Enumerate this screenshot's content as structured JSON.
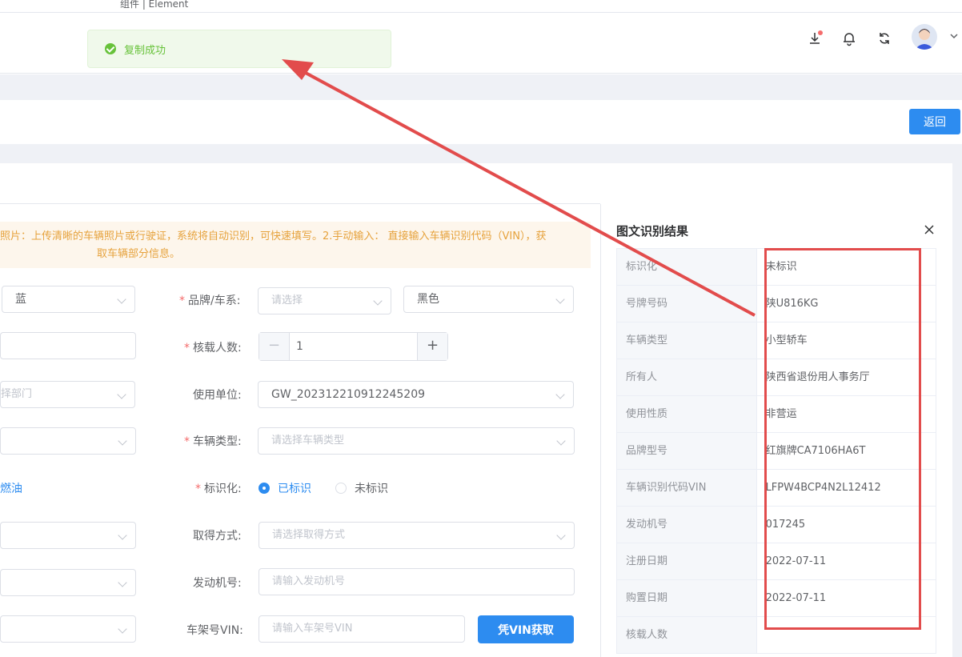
{
  "bookmarks": [
    "组件 | Element",
    "...",
    "...",
    "...",
    "..."
  ],
  "toast": {
    "message": "复制成功"
  },
  "header": {
    "back_label": "返回"
  },
  "notice": {
    "line1": "照片：上传清晰的车辆照片或行驶证，系统将自动识别，可快速填写。2.手动输入： 直接输入车辆识别代码（VIN），获",
    "line2": "取车辆部分信息。"
  },
  "form": {
    "color_left": "蓝",
    "brand_label": "品牌/车系:",
    "brand_placeholder": "请选择",
    "color_right": "黑色",
    "seats_label": "核载人数:",
    "seats_value": "1",
    "dept_placeholder": "择部门",
    "unit_label": "使用单位:",
    "unit_value": "GW_202312210912245209",
    "type_label": "车辆类型:",
    "type_placeholder": "请选择车辆类型",
    "fuel_label": "燃油",
    "marked_label": "标识化:",
    "marked_yes": "已标识",
    "marked_no": "未标识",
    "acquire_label": "取得方式:",
    "acquire_placeholder": "请选择取得方式",
    "engine_label": "发动机号:",
    "engine_placeholder": "请输入发动机号",
    "vin_label": "车架号VIN:",
    "vin_placeholder": "请输入车架号VIN",
    "vin_button": "凭VIN获取"
  },
  "panel": {
    "title": "图文识别结果",
    "rows": [
      {
        "key": "标识化",
        "value": "未标识"
      },
      {
        "key": "号牌号码",
        "value": "陕U816KG"
      },
      {
        "key": "车辆类型",
        "value": "小型轿车"
      },
      {
        "key": "所有人",
        "value": "陕西省退份用人事务厅"
      },
      {
        "key": "使用性质",
        "value": "非营运"
      },
      {
        "key": "品牌型号",
        "value": "红旗牌CA7106HA6T"
      },
      {
        "key": "车辆识别代码VIN",
        "value": "LFPW4BCP4N2L12412"
      },
      {
        "key": "发动机号",
        "value": "017245"
      },
      {
        "key": "注册日期",
        "value": "2022-07-11"
      },
      {
        "key": "购置日期",
        "value": "2022-07-11"
      },
      {
        "key": "核载人数",
        "value": ""
      }
    ]
  },
  "colors": {
    "primary": "#2d8cf0",
    "success": "#67c23a",
    "warning": "#e6a23c",
    "annotation_red": "#e24c4c"
  }
}
